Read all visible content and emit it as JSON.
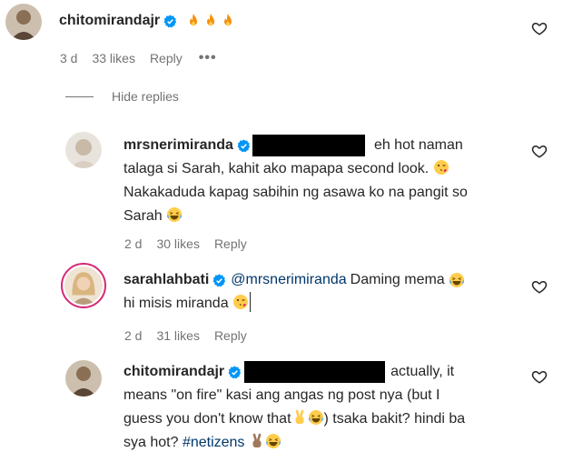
{
  "comments": [
    {
      "username": "chitomirandajr",
      "verified": true,
      "meta": {
        "time": "3 d",
        "likes": "33 likes",
        "reply": "Reply",
        "more": "•••"
      }
    }
  ],
  "hide_replies": "Hide replies",
  "replies": [
    {
      "username": "mrsnerimiranda",
      "verified": true,
      "text_after_redaction": "eh hot naman",
      "lines": [
        "talaga si Sarah, kahit ako mapapa second look.",
        "Nakakaduda kapag sabihin ng asawa ko na pangit so",
        "Sarah"
      ],
      "meta": {
        "time": "2 d",
        "likes": "30 likes",
        "reply": "Reply"
      }
    },
    {
      "username": "sarahlahbati",
      "verified": true,
      "mention": "@mrsnerimiranda",
      "text_after_mention": "Daming mema",
      "line2": "hi misis miranda",
      "meta": {
        "time": "2 d",
        "likes": "31 likes",
        "reply": "Reply"
      }
    },
    {
      "username": "chitomirandajr",
      "verified": true,
      "text_after_redaction": "actually, it",
      "line1": "means \"on fire\" kasi ang angas ng post nya (but I",
      "line2a": "guess you don't know that",
      "line2b": ") tsaka bakit? hindi ba",
      "line3a": "sya hot?",
      "hashtag": "#netizens"
    }
  ],
  "colors": {
    "text": "#262626",
    "muted": "#737373",
    "link": "#00376b",
    "verified": "#0095f6"
  },
  "icons": [
    "heart-icon",
    "verified-badge-icon",
    "fire-emoji-icon",
    "winking-kiss-emoji-icon",
    "laughing-emoji-icon",
    "victory-hand-emoji-icon"
  ]
}
